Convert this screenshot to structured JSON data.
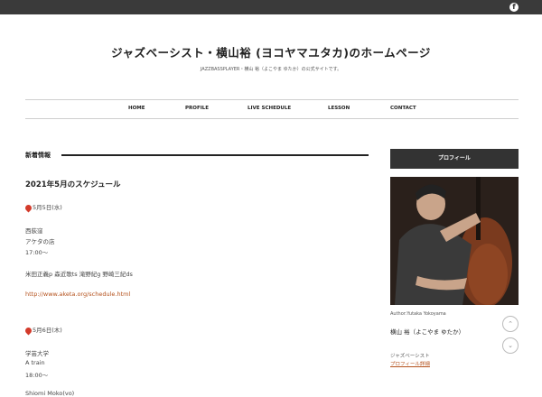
{
  "topbar": {
    "facebook_icon_glyph": "f"
  },
  "header": {
    "title": "ジャズベーシスト・横山裕 (ヨコヤマユタカ)のホームページ",
    "tagline": "JAZZBASSPLAYER・横山 裕（よこやま ゆたか）の公式サイトです。"
  },
  "nav": [
    "HOME",
    "PROFILE",
    "LIVE SCHEDULE",
    "LESSON",
    "CONTACT"
  ],
  "main": {
    "section_heading": "新着情報",
    "post_title": "2021年5月のスケジュール",
    "lines": [
      "5月5日(水)",
      "西荻窪",
      "アケタの店",
      "17:00〜",
      "米田正義p 森近歌ts 滝野紀g 野崎三紀ds",
      "http://www.aketa.org/schedule.html",
      "5月6日(木)",
      "学芸大学",
      "A train",
      "18:00〜",
      "Shiomi Moko(vo)"
    ]
  },
  "sidebar": {
    "heading": "プロフィール",
    "photo_caption": "Author:Yutaka Yokoyama",
    "name": "横山 裕（よこやま ゆたか）",
    "role": "ジャズベーシスト",
    "more_link": "プロフィール詳細"
  },
  "scroll": {
    "up_glyph": "⌃",
    "down_glyph": "⌄"
  }
}
